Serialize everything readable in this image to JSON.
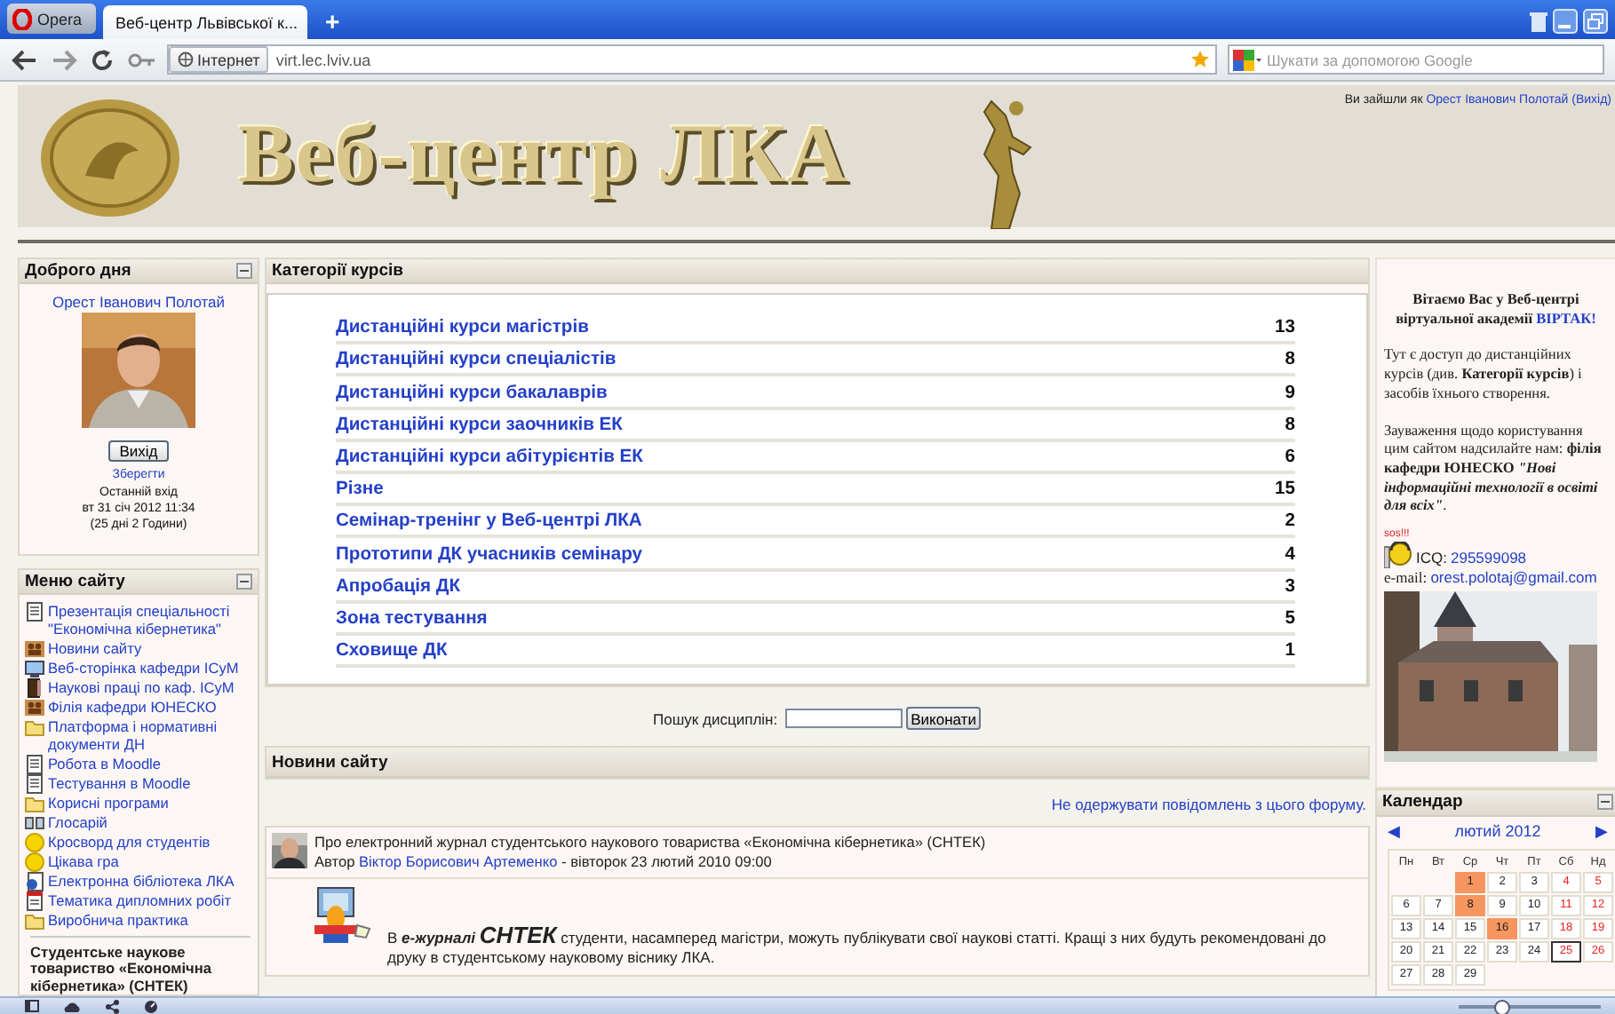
{
  "browser": {
    "opera_button": "Opera",
    "tabs": [
      {
        "title": "Веб-центр Львівської к...",
        "selected": true
      }
    ],
    "new_tab": "+",
    "address": {
      "security_badge": "Інтернет",
      "url": "virt.lec.lviv.ua"
    },
    "search": {
      "placeholder": "Шукати за допомогою Google"
    }
  },
  "header": {
    "title": "Веб-центр ЛКА",
    "login_info": {
      "prefix": "Ви зайшли як",
      "user": "Орест Іванович Полотай",
      "logout": "(Вихід)"
    }
  },
  "left": {
    "greeting_block": {
      "title": "Доброго дня",
      "user": "Орест Іванович Полотай",
      "logout_button": "Вихід",
      "save_link": "Зберегти",
      "last_login_label": "Останній вхід",
      "last_login_date": "вт 31 січ 2012 11:34",
      "last_login_ago": "(25 дні 2 Години)"
    },
    "menu_block": {
      "title": "Меню сайту",
      "items": [
        {
          "label": "Презентація спеціальності \"Економічна кібернетика\"",
          "kind": "page"
        },
        {
          "label": "Новини сайту",
          "kind": "forum"
        },
        {
          "label": "Веб-сторінка кафедри ІСуМ",
          "kind": "link"
        },
        {
          "label": "Наукові праці по каф. ІСуМ",
          "kind": "book"
        },
        {
          "label": "Філія кафедри ЮНЕСКО",
          "kind": "forum"
        },
        {
          "label": "Платформа і нормативні документи ДН",
          "kind": "folder"
        },
        {
          "label": "Робота в Moodle",
          "kind": "page"
        },
        {
          "label": "Тестування в Moodle",
          "kind": "page"
        },
        {
          "label": "Корисні програми",
          "kind": "folder"
        },
        {
          "label": "Глосарій",
          "kind": "glossary"
        },
        {
          "label": "Кросворд для студентів",
          "kind": "game"
        },
        {
          "label": "Цікава гра",
          "kind": "game"
        },
        {
          "label": "Електронна бібліотека ЛКА",
          "kind": "library"
        },
        {
          "label": "Тематика дипломних робіт",
          "kind": "document"
        },
        {
          "label": "Виробнича практика",
          "kind": "folder"
        }
      ]
    },
    "next_block_title": "Студентське наукове товариство «Економічна кібернетика» (СНТЕК)"
  },
  "center": {
    "categories": {
      "title": "Категорії курсів",
      "rows": [
        {
          "name": "Дистанційні курси магістрів",
          "count": "13"
        },
        {
          "name": "Дистанційні курси спеціалістів",
          "count": "8"
        },
        {
          "name": "Дистанційні курси бакалаврів",
          "count": "9"
        },
        {
          "name": "Дистанційні курси заочників ЕК",
          "count": "8"
        },
        {
          "name": "Дистанційні курси абітурієнтів ЕК",
          "count": "6"
        },
        {
          "name": "Різне",
          "count": "15"
        },
        {
          "name": "Семінар-тренінг у Веб-центрі ЛКА",
          "count": "2"
        },
        {
          "name": "Прототипи ДК учасників семінару",
          "count": "4"
        },
        {
          "name": "Апробація ДК",
          "count": "3"
        },
        {
          "name": "Зона тестування",
          "count": "5"
        },
        {
          "name": "Сховище ДК",
          "count": "1"
        }
      ]
    },
    "search": {
      "label": "Пошук дисциплін:",
      "button": "Виконати"
    },
    "news": {
      "title": "Новини сайту",
      "unsubscribe": "Не одержувати повідомлень з цього форуму.",
      "posts": [
        {
          "subject": "Про електронний журнал студентського наукового товариства «Економічна кібернетика» (СНТЕК)",
          "author_label": "Автор",
          "author": "Віктор Борисович Артеменко",
          "date": "- вівторок 23 лютий 2010 09:00",
          "body": "В *е-журналі* **СНТЕК** студенти, насамперед магістри, можуть публікувати свої наукові статті. Кращі з них будуть рекомендовані до друку в студентському науковому віснику ЛКА."
        }
      ]
    }
  },
  "right": {
    "welcome": {
      "heading": "Вітаємо Вас у Веб-центрі віртуальної академії",
      "heading_link": "ВІРТАК!",
      "access_text": "Тут є доступ до дистанційних курсів (див. **Категорії курсів**) і засобів їхнього створення.",
      "feedback_text": "Зауваження щодо користування цим сайтом надсилайте нам: **філія кафедри ЮНЕСКО** *\"Нові інформаційні технології в освіті для всіх\"*.",
      "sos": "sos!!!",
      "icq_label": "ICQ:",
      "icq": "295599098",
      "email_label": "e-mail:",
      "email": "orest.polotaj@gmail.com"
    },
    "calendar": {
      "title": "Календар",
      "prev": "◀",
      "month": "лютий 2012",
      "next": "▶",
      "weekdays": [
        "Пн",
        "Вт",
        "Ср",
        "Чт",
        "Пт",
        "Сб",
        "Нд"
      ],
      "weeks": [
        [
          {
            "kind": "blank"
          },
          {
            "kind": "blank"
          },
          {
            "kind": "day",
            "day": "1",
            "event": true,
            "weekend": false,
            "today": false
          },
          {
            "kind": "day",
            "day": "2",
            "event": false,
            "weekend": false,
            "today": false
          },
          {
            "kind": "day",
            "day": "3",
            "event": false,
            "weekend": false,
            "today": false
          },
          {
            "kind": "day",
            "day": "4",
            "event": false,
            "weekend": true,
            "today": false
          },
          {
            "kind": "day",
            "day": "5",
            "event": false,
            "weekend": true,
            "today": false
          }
        ],
        [
          {
            "kind": "day",
            "day": "6",
            "event": false,
            "weekend": false,
            "today": false
          },
          {
            "kind": "day",
            "day": "7",
            "event": false,
            "weekend": false,
            "today": false
          },
          {
            "kind": "day",
            "day": "8",
            "event": true,
            "weekend": false,
            "today": false
          },
          {
            "kind": "day",
            "day": "9",
            "event": false,
            "weekend": false,
            "today": false
          },
          {
            "kind": "day",
            "day": "10",
            "event": false,
            "weekend": false,
            "today": false
          },
          {
            "kind": "day",
            "day": "11",
            "event": false,
            "weekend": true,
            "today": false
          },
          {
            "kind": "day",
            "day": "12",
            "event": false,
            "weekend": true,
            "today": false
          }
        ],
        [
          {
            "kind": "day",
            "day": "13",
            "event": false,
            "weekend": false,
            "today": false
          },
          {
            "kind": "day",
            "day": "14",
            "event": false,
            "weekend": false,
            "today": false
          },
          {
            "kind": "day",
            "day": "15",
            "event": false,
            "weekend": false,
            "today": false
          },
          {
            "kind": "day",
            "day": "16",
            "event": true,
            "weekend": false,
            "today": false
          },
          {
            "kind": "day",
            "day": "17",
            "event": false,
            "weekend": false,
            "today": false
          },
          {
            "kind": "day",
            "day": "18",
            "event": false,
            "weekend": true,
            "today": false
          },
          {
            "kind": "day",
            "day": "19",
            "event": false,
            "weekend": true,
            "today": false
          }
        ],
        [
          {
            "kind": "day",
            "day": "20",
            "event": false,
            "weekend": false,
            "today": false
          },
          {
            "kind": "day",
            "day": "21",
            "event": false,
            "weekend": false,
            "today": false
          },
          {
            "kind": "day",
            "day": "22",
            "event": false,
            "weekend": false,
            "today": false
          },
          {
            "kind": "day",
            "day": "23",
            "event": false,
            "weekend": false,
            "today": false
          },
          {
            "kind": "day",
            "day": "24",
            "event": false,
            "weekend": false,
            "today": false
          },
          {
            "kind": "day",
            "day": "25",
            "event": false,
            "weekend": true,
            "today": true
          },
          {
            "kind": "day",
            "day": "26",
            "event": false,
            "weekend": true,
            "today": false
          }
        ],
        [
          {
            "kind": "day",
            "day": "27",
            "event": false,
            "weekend": false,
            "today": false
          },
          {
            "kind": "day",
            "day": "28",
            "event": false,
            "weekend": false,
            "today": false
          },
          {
            "kind": "day",
            "day": "29",
            "event": false,
            "weekend": false,
            "today": false
          }
        ]
      ]
    }
  },
  "status_bar": {
    "zoom": {
      "level": 0.3
    }
  }
}
